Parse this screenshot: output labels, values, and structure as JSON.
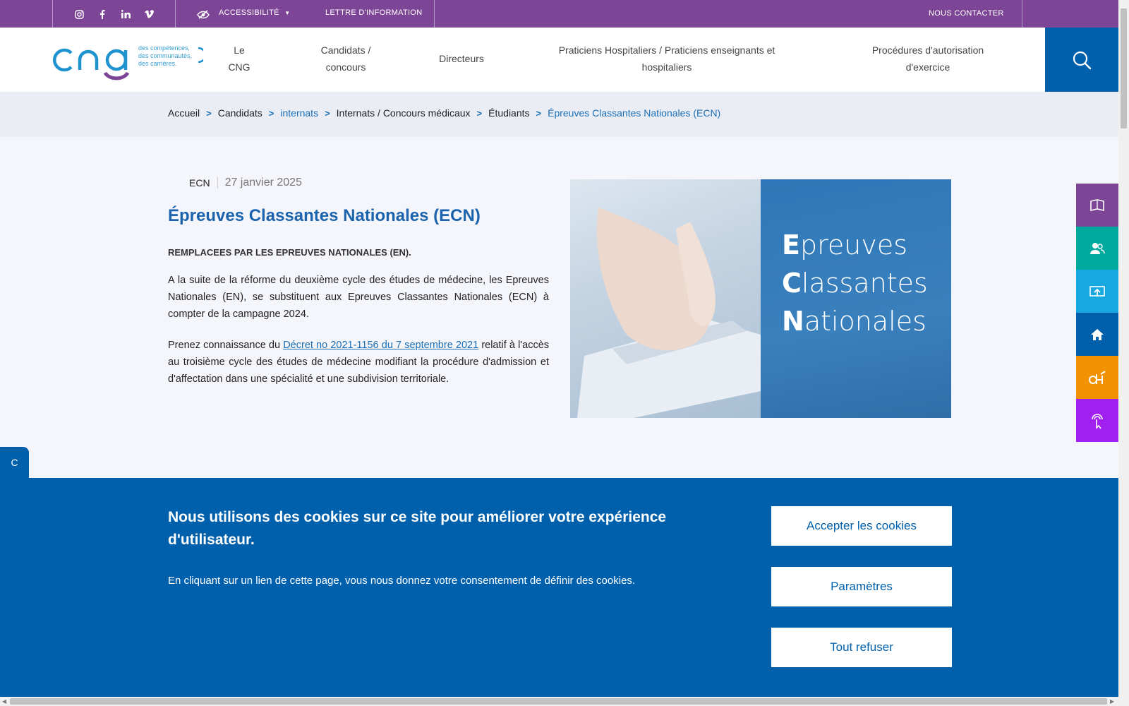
{
  "topbar": {
    "accessibility": "ACCESSIBILITÉ",
    "newsletter": "LETTRE D'INFORMATION",
    "contact": "NOUS CONTACTER"
  },
  "logo": {
    "wordmark": "cng",
    "tagline_1": "des compétences,",
    "tagline_2": "des communautés,",
    "tagline_3": "des carrières."
  },
  "nav": {
    "items": [
      {
        "line1": "Le",
        "line2": "CNG"
      },
      {
        "line1": "Candidats /",
        "line2": "concours"
      },
      {
        "line1": "Directeurs",
        "line2": ""
      },
      {
        "line1": "Praticiens Hospitaliers / Praticiens enseignants et",
        "line2": "hospitaliers"
      },
      {
        "line1": "Procédures d'autorisation",
        "line2": "d'exercice"
      }
    ]
  },
  "breadcrumb": {
    "items": [
      "Accueil",
      "Candidats",
      "internats",
      "Internats / Concours médicaux",
      "Étudiants",
      "Épreuves Classantes Nationales (ECN)"
    ]
  },
  "article": {
    "category": "ECN",
    "date": "27 janvier 2025",
    "title": "Épreuves Classantes Nationales (ECN)",
    "lead": "REMPLACEES PAR LES EPREUVES NATIONALES (EN).",
    "para1": "A la suite de la réforme du deuxième cycle des études de médecine, les Epreuves Nationales (EN), se substituent aux Epreuves Classantes Nationales (ECN) à compter de la campagne 2024.",
    "para2_before": "Prenez connaissance du ",
    "para2_link": "Décret no 2021-1156 du 7 septembre 2021",
    "para2_after": " relatif à l'accès au troisième cycle des études de médecine modifiant la procédure d'admission et d'affectation dans une spécialité et une subdivision territoriale."
  },
  "hero": {
    "w1_initial": "E",
    "w1_rest": "preuves",
    "w2_initial": "C",
    "w2_rest": "lassantes",
    "w3_initial": "N",
    "w3_rest": "ationales"
  },
  "cookie": {
    "tab": "C",
    "heading": "Nous utilisons des cookies sur ce site pour améliorer votre expérience d'utilisateur.",
    "text": "En cliquant sur un lien de cette page, vous nous donnez votre consentement de définir des cookies.",
    "accept": "Accepter les cookies",
    "settings": "Paramètres",
    "refuse": "Tout refuser"
  },
  "colors": {
    "topbar": "#7d4596",
    "primary": "#0060ac",
    "tab_purple": "#7d4596",
    "tab_green": "#00a99d",
    "tab_cyan": "#17a8e0",
    "tab_blue": "#0060ac",
    "tab_orange": "#f39200",
    "tab_violet": "#a020f0"
  },
  "icons": [
    "instagram-icon",
    "facebook-icon",
    "linkedin-icon",
    "vimeo-icon",
    "eye-slash-icon",
    "search-icon",
    "book-icon",
    "users-icon",
    "upload-icon",
    "home-icon",
    "dh-icon",
    "pointer-icon"
  ]
}
